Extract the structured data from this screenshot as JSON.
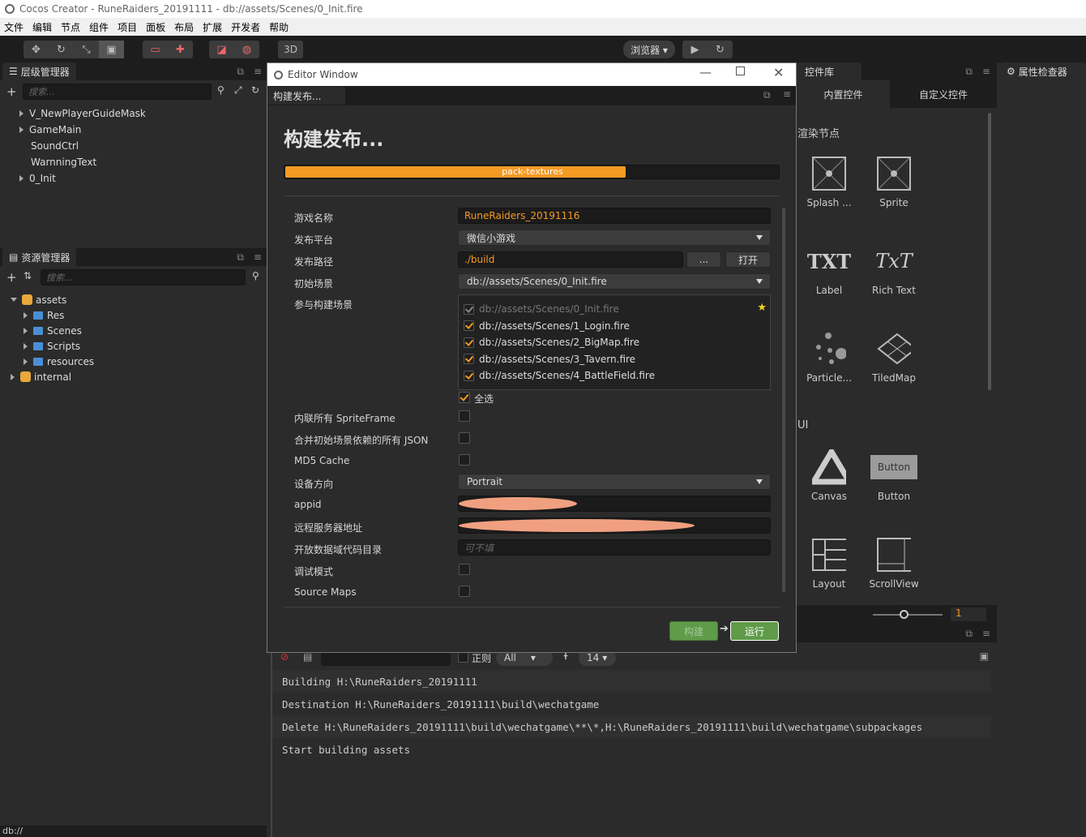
{
  "window": {
    "title": "Cocos Creator - RuneRaiders_20191111 - db://assets/Scenes/0_Init.fire"
  },
  "menu": [
    "文件",
    "编辑",
    "节点",
    "组件",
    "项目",
    "面板",
    "布局",
    "扩展",
    "开发者",
    "帮助"
  ],
  "toolbar": {
    "mode_3d": "3D",
    "preview_select": "浏览器 ▾"
  },
  "hierarchy": {
    "title": "层级管理器",
    "search_placeholder": "搜索...",
    "nodes": [
      "V_NewPlayerGuideMask",
      "GameMain",
      "SoundCtrl",
      "WarnningText",
      "0_Init"
    ]
  },
  "assets": {
    "title": "资源管理器",
    "search_placeholder": "搜索...",
    "root": "assets",
    "folders": [
      "Res",
      "Scenes",
      "Scripts",
      "resources"
    ],
    "internal": "internal",
    "status": "db://"
  },
  "editor_window": {
    "title": "Editor Window",
    "tab": "构建发布...",
    "heading": "构建发布...",
    "progress_label": "pack-textures",
    "progress": 0.69,
    "accent": "#f59a23",
    "labels": {
      "game_name": "游戏名称",
      "platform": "发布平台",
      "path": "发布路径",
      "start_scene": "初始场景",
      "scenes": "参与构建场景",
      "inline_sprite": "内联所有 SpriteFrame",
      "merge_json": "合并初始场景依赖的所有 JSON",
      "md5": "MD5 Cache",
      "orientation": "设备方向",
      "appid": "appid",
      "remote_server": "远程服务器地址",
      "open_data": "开放数据域代码目录",
      "debug": "调试模式",
      "source_maps": "Source Maps"
    },
    "values": {
      "game_name": "RuneRaiders_20191116",
      "platform": "微信小游戏",
      "path": "./build",
      "start_scene": "db://assets/Scenes/0_Init.fire",
      "orientation": "Portrait",
      "open_data_placeholder": "可不填"
    },
    "browse_button": "...",
    "open_button": "打开",
    "scenes": [
      "db://assets/Scenes/0_Init.fire",
      "db://assets/Scenes/1_Login.fire",
      "db://assets/Scenes/2_BigMap.fire",
      "db://assets/Scenes/3_Tavern.fire",
      "db://assets/Scenes/4_BattleField.fire"
    ],
    "select_all": "全选",
    "build_button": "构建",
    "run_button": "运行"
  },
  "widget_library": {
    "title": "控件库",
    "tabs": [
      "内置控件",
      "自定义控件"
    ],
    "section_render": "渲染节点",
    "section_ui": "UI",
    "items": [
      "Splash ...",
      "Sprite",
      "Label",
      "Rich Text",
      "Particle...",
      "TiledMap",
      "Canvas",
      "Button",
      "Layout",
      "ScrollView"
    ],
    "button_preview": "Button",
    "txt_icon": "TXT",
    "richtext_icon": "TxT",
    "zoom_value": "1"
  },
  "inspector": {
    "title": "属性检查器"
  },
  "console": {
    "regex_label": "正则",
    "level": "All",
    "font_size": "14",
    "lines": [
      "Building H:\\RuneRaiders_20191111",
      "Destination H:\\RuneRaiders_20191111\\build\\wechatgame",
      "Delete H:\\RuneRaiders_20191111\\build\\wechatgame\\**\\*,H:\\RuneRaiders_20191111\\build\\wechatgame\\subpackages",
      "Start building assets"
    ]
  }
}
